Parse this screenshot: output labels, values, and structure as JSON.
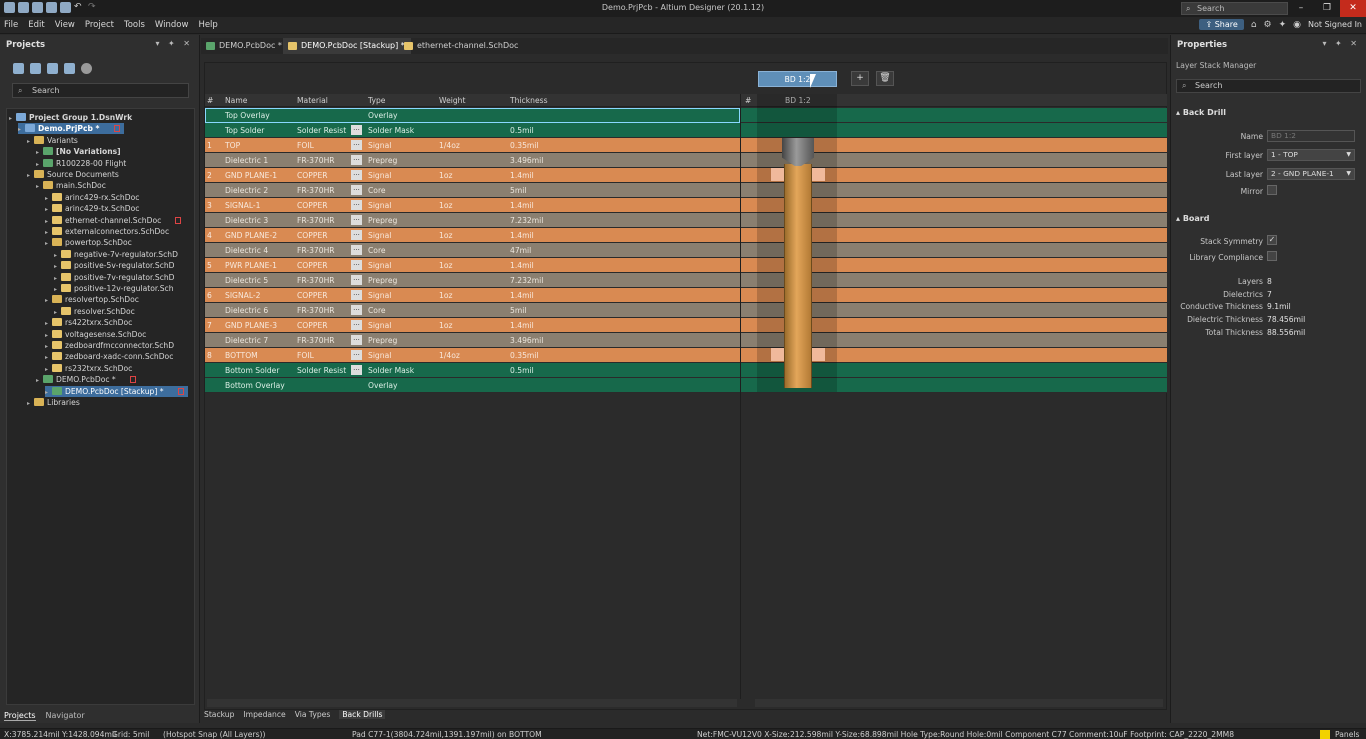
{
  "window": {
    "title": "Demo.PrjPcb - Altium Designer (20.1.12)",
    "search_placeholder": "Search"
  },
  "menu": [
    "File",
    "Edit",
    "View",
    "Project",
    "Tools",
    "Window",
    "Help"
  ],
  "menu_right": {
    "share": "Share",
    "signed_in": "Not Signed In"
  },
  "projects_panel": {
    "title": "Projects",
    "search_placeholder": "Search",
    "tree": [
      {
        "label": "Project Group 1.DsnWrk",
        "depth": 0,
        "icon": "workspace-icon",
        "bold": true
      },
      {
        "label": "Demo.PrjPcb *",
        "depth": 1,
        "icon": "project-icon",
        "bold": true,
        "modified": true,
        "selected": true
      },
      {
        "label": "Variants",
        "depth": 2,
        "icon": "folder-icon"
      },
      {
        "label": "[No Variations]",
        "depth": 3,
        "icon": "variant-icon",
        "bold": true
      },
      {
        "label": "R100228-00 Flight",
        "depth": 3,
        "icon": "variant-icon"
      },
      {
        "label": "Source Documents",
        "depth": 2,
        "icon": "folder-icon"
      },
      {
        "label": "main.SchDoc",
        "depth": 3,
        "icon": "folder-icon"
      },
      {
        "label": "arinc429-rx.SchDoc",
        "depth": 4,
        "icon": "schdoc-icon"
      },
      {
        "label": "arinc429-tx.SchDoc",
        "depth": 4,
        "icon": "schdoc-icon"
      },
      {
        "label": "ethernet-channel.SchDoc",
        "depth": 4,
        "icon": "schdoc-icon",
        "modified": true
      },
      {
        "label": "externalconnectors.SchDoc",
        "depth": 4,
        "icon": "schdoc-icon"
      },
      {
        "label": "powertop.SchDoc",
        "depth": 4,
        "icon": "folder-icon"
      },
      {
        "label": "negative-7v-regulator.SchD",
        "depth": 5,
        "icon": "schdoc-icon"
      },
      {
        "label": "positive-5v-regulator.SchD",
        "depth": 5,
        "icon": "schdoc-icon"
      },
      {
        "label": "positive-7v-regulator.SchD",
        "depth": 5,
        "icon": "schdoc-icon"
      },
      {
        "label": "positive-12v-regulator.Sch",
        "depth": 5,
        "icon": "schdoc-icon"
      },
      {
        "label": "resolvertop.SchDoc",
        "depth": 4,
        "icon": "folder-icon"
      },
      {
        "label": "resolver.SchDoc",
        "depth": 5,
        "icon": "schdoc-icon"
      },
      {
        "label": "rs422txrx.SchDoc",
        "depth": 4,
        "icon": "schdoc-icon"
      },
      {
        "label": "voltagesense.SchDoc",
        "depth": 4,
        "icon": "schdoc-icon"
      },
      {
        "label": "zedboardfmcconnector.SchD",
        "depth": 4,
        "icon": "schdoc-icon"
      },
      {
        "label": "zedboard-xadc-conn.SchDoc",
        "depth": 4,
        "icon": "schdoc-icon"
      },
      {
        "label": "rs232txrx.SchDoc",
        "depth": 4,
        "icon": "schdoc-icon"
      },
      {
        "label": "DEMO.PcbDoc *",
        "depth": 3,
        "icon": "pcbdoc-icon",
        "modified": true
      },
      {
        "label": "DEMO.PcbDoc [Stackup] *",
        "depth": 4,
        "icon": "pcbdoc-icon",
        "modified": true,
        "selected": true
      },
      {
        "label": "Libraries",
        "depth": 2,
        "icon": "folder-icon"
      }
    ],
    "tabs": [
      "Projects",
      "Navigator"
    ]
  },
  "doc_tabs": [
    {
      "label": "DEMO.PcbDoc *",
      "active": false,
      "icon": "pcbdoc-icon"
    },
    {
      "label": "DEMO.PcbDoc [Stackup] *",
      "active": true,
      "icon": "schdoc-icon"
    },
    {
      "label": "ethernet-channel.SchDoc",
      "active": false,
      "icon": "schdoc-icon"
    }
  ],
  "stack_table": {
    "headers": [
      "#",
      "Name",
      "Material",
      "Type",
      "Weight",
      "Thickness"
    ],
    "rows": [
      {
        "num": "",
        "name": "Top Overlay",
        "material": "",
        "type": "Overlay",
        "weight": "",
        "thickness": "",
        "kind": "overlay",
        "dd": false
      },
      {
        "num": "",
        "name": "Top Solder",
        "material": "Solder Resist",
        "type": "Solder Mask",
        "weight": "",
        "thickness": "0.5mil",
        "kind": "mask",
        "dd": true
      },
      {
        "num": "1",
        "name": "TOP",
        "material": "FOIL",
        "type": "Signal",
        "weight": "1/4oz",
        "thickness": "0.35mil",
        "kind": "signal",
        "dd": true
      },
      {
        "num": "",
        "name": "Dielectric 1",
        "material": "FR-370HR",
        "type": "Prepreg",
        "weight": "",
        "thickness": "3.496mil",
        "kind": "dielectric",
        "dd": true
      },
      {
        "num": "2",
        "name": "GND PLANE-1",
        "material": "COPPER",
        "type": "Signal",
        "weight": "1oz",
        "thickness": "1.4mil",
        "kind": "signal",
        "dd": true
      },
      {
        "num": "",
        "name": "Dielectric 2",
        "material": "FR-370HR",
        "type": "Core",
        "weight": "",
        "thickness": "5mil",
        "kind": "dielectric",
        "dd": true
      },
      {
        "num": "3",
        "name": "SIGNAL-1",
        "material": "COPPER",
        "type": "Signal",
        "weight": "1oz",
        "thickness": "1.4mil",
        "kind": "signal",
        "dd": true
      },
      {
        "num": "",
        "name": "Dielectric 3",
        "material": "FR-370HR",
        "type": "Prepreg",
        "weight": "",
        "thickness": "7.232mil",
        "kind": "dielectric",
        "dd": true
      },
      {
        "num": "4",
        "name": "GND PLANE-2",
        "material": "COPPER",
        "type": "Signal",
        "weight": "1oz",
        "thickness": "1.4mil",
        "kind": "signal",
        "dd": true
      },
      {
        "num": "",
        "name": "Dielectric 4",
        "material": "FR-370HR",
        "type": "Core",
        "weight": "",
        "thickness": "47mil",
        "kind": "dielectric",
        "dd": true
      },
      {
        "num": "5",
        "name": "PWR PLANE-1",
        "material": "COPPER",
        "type": "Signal",
        "weight": "1oz",
        "thickness": "1.4mil",
        "kind": "signal",
        "dd": true
      },
      {
        "num": "",
        "name": "Dielectric 5",
        "material": "FR-370HR",
        "type": "Prepreg",
        "weight": "",
        "thickness": "7.232mil",
        "kind": "dielectric",
        "dd": true
      },
      {
        "num": "6",
        "name": "SIGNAL-2",
        "material": "COPPER",
        "type": "Signal",
        "weight": "1oz",
        "thickness": "1.4mil",
        "kind": "signal",
        "dd": true
      },
      {
        "num": "",
        "name": "Dielectric 6",
        "material": "FR-370HR",
        "type": "Core",
        "weight": "",
        "thickness": "5mil",
        "kind": "dielectric",
        "dd": true
      },
      {
        "num": "7",
        "name": "GND PLANE-3",
        "material": "COPPER",
        "type": "Signal",
        "weight": "1oz",
        "thickness": "1.4mil",
        "kind": "signal",
        "dd": true
      },
      {
        "num": "",
        "name": "Dielectric 7",
        "material": "FR-370HR",
        "type": "Prepreg",
        "weight": "",
        "thickness": "3.496mil",
        "kind": "dielectric",
        "dd": true
      },
      {
        "num": "8",
        "name": "BOTTOM",
        "material": "FOIL",
        "type": "Signal",
        "weight": "1/4oz",
        "thickness": "0.35mil",
        "kind": "signal",
        "dd": true
      },
      {
        "num": "",
        "name": "Bottom Solder",
        "material": "Solder Resist",
        "type": "Solder Mask",
        "weight": "",
        "thickness": "0.5mil",
        "kind": "mask",
        "dd": true
      },
      {
        "num": "",
        "name": "Bottom Overlay",
        "material": "",
        "type": "Overlay",
        "weight": "",
        "thickness": "",
        "kind": "overlay",
        "dd": false
      }
    ]
  },
  "drill_view": {
    "header_num": "#",
    "header_col": "BD 1:2",
    "toolbar_label": "BD 1:2",
    "add_label": "+",
    "delete_label": "🗑"
  },
  "bottom_tabs": [
    {
      "label": "Stackup",
      "active": false
    },
    {
      "label": "Impedance",
      "active": false
    },
    {
      "label": "Via Types",
      "active": false
    },
    {
      "label": "Back Drills",
      "active": true
    }
  ],
  "properties": {
    "title": "Properties",
    "subtitle": "Layer Stack Manager",
    "search_placeholder": "Search",
    "back_drill": {
      "section": "Back Drill",
      "name_label": "Name",
      "name_value": "BD 1:2",
      "first_label": "First layer",
      "first_value": "1 - TOP",
      "last_label": "Last layer",
      "last_value": "2 - GND PLANE-1",
      "mirror_label": "Mirror"
    },
    "board": {
      "section": "Board",
      "stack_symmetry_label": "Stack Symmetry",
      "library_compliance_label": "Library Compliance",
      "stats": [
        {
          "label": "Layers",
          "value": "8"
        },
        {
          "label": "Dielectrics",
          "value": "7"
        },
        {
          "label": "Conductive Thickness",
          "value": "9.1mil"
        },
        {
          "label": "Dielectric Thickness",
          "value": "78.456mil"
        },
        {
          "label": "Total Thickness",
          "value": "88.556mil"
        }
      ]
    }
  },
  "status": {
    "coords": "X:3785.214mil Y:1428.094mil",
    "grid": "Grid: 5mil",
    "snap": "(Hotspot Snap (All Layers))",
    "pad": "Pad C77-1(3804.724mil,1391.197mil) on BOTTOM",
    "net": "Net:FMC-VU12V0 X-Size:212.598mil Y-Size:68.898mil Hole Type:Round Hole:0mil  Component C77 Comment:10uF Footprint: CAP_2220_2MM8",
    "panels": "Panels"
  },
  "colors": {
    "signal": "#d98a52",
    "dielectric": "#8a7f70",
    "mask": "#17694b",
    "selection": "#3d6d9d"
  }
}
